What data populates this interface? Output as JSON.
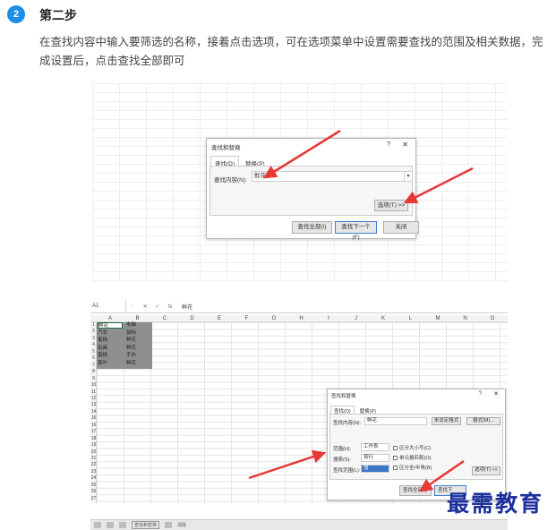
{
  "step": {
    "number": "2",
    "title": "第二步",
    "description": "在查找内容中输入要筛选的名称，接着点击选项，可在选项菜单中设置需要查找的范围及相关数据，完成设置后，点击查找全部即可"
  },
  "dialog1": {
    "title": "查找和替换",
    "help": "?",
    "close": "✕",
    "tab_find": "查找(D)",
    "tab_replace": "替换(P)",
    "find_label": "查找内容(N):",
    "find_value": "鲜花",
    "options_button": "选项(T) >>",
    "find_all": "查找全部(I)",
    "find_next": "查找下一个(F)",
    "close_button": "关闭"
  },
  "sheet": {
    "cell_ref": "A1",
    "formula_value": "鲜花",
    "columns": [
      "A",
      "B",
      "C",
      "D",
      "E",
      "F",
      "G",
      "H",
      "I",
      "J",
      "K",
      "L",
      "M",
      "N",
      "O"
    ],
    "rows": [
      "1",
      "2",
      "3",
      "4",
      "5",
      "6",
      "7",
      "8",
      "9",
      "10",
      "11",
      "12",
      "13",
      "14",
      "15",
      "16",
      "17",
      "18",
      "19",
      "20",
      "21",
      "22",
      "23",
      "24",
      "25",
      "26",
      "27"
    ],
    "col_a": [
      "鲜花",
      "汽车",
      "蜜桃",
      "玩具",
      "蜜桃",
      "茶叶"
    ],
    "col_b": [
      "电脑",
      "鼠标",
      "鲜花",
      "鲜花",
      "手办",
      "鲜花"
    ]
  },
  "dialog2": {
    "title": "查找和替换",
    "help": "?",
    "close": "✕",
    "tab_find": "查找(D)",
    "tab_replace": "替换(P)",
    "find_label": "查找内容(N):",
    "find_value": "鲜花",
    "no_format": "未设定格式",
    "format_button": "格式(M)...",
    "within_label": "范围(H):",
    "within_value": "工作表",
    "search_label": "搜索(S):",
    "search_value": "按行",
    "lookin_label": "查找范围(L):",
    "lookin_value": "值",
    "match_case": "区分大小写(C)",
    "match_cell": "单元格匹配(O)",
    "match_byte": "区分全/半角(B)",
    "options_button": "选项(T) <<",
    "find_all": "查找全部(I)",
    "find_next": "查找下"
  },
  "taskbar": {
    "label": "查找和替换",
    "clear": "清除"
  },
  "watermark": "最需教育",
  "colors": {
    "accent": "#1a8fe3",
    "arrow": "#e53935",
    "watermark": "#1c2f9c"
  }
}
